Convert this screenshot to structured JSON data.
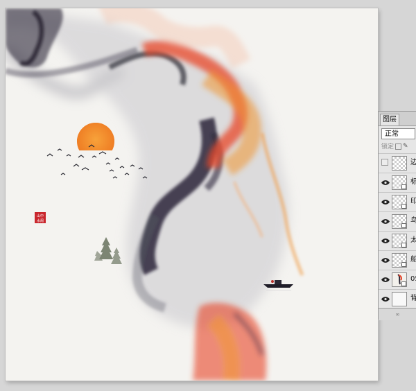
{
  "layers_panel": {
    "tab_label": "图层",
    "blend_mode": "正常",
    "lock_label": "锁定",
    "layers": [
      {
        "name": "边",
        "visible": false,
        "thumb": "transparent",
        "smart": false
      },
      {
        "name": "标",
        "visible": true,
        "thumb": "transparent",
        "smart": true
      },
      {
        "name": "印",
        "visible": true,
        "thumb": "transparent",
        "smart": true
      },
      {
        "name": "鸟",
        "visible": true,
        "thumb": "transparent",
        "smart": true
      },
      {
        "name": "太",
        "visible": true,
        "thumb": "transparent",
        "smart": true
      },
      {
        "name": "船",
        "visible": true,
        "thumb": "transparent",
        "smart": true
      },
      {
        "name": "05",
        "visible": true,
        "thumb": "art",
        "smart": true
      },
      {
        "name": "背",
        "visible": true,
        "thumb": "solid",
        "smart": false
      }
    ],
    "footer_icons": "link-icon"
  },
  "artwork": {
    "seal_text": "山中\n水阁",
    "sun_color": "#f08a2c",
    "ink_color": "#25223a",
    "red_color": "#e8452a",
    "orange_color": "#f0952e"
  }
}
